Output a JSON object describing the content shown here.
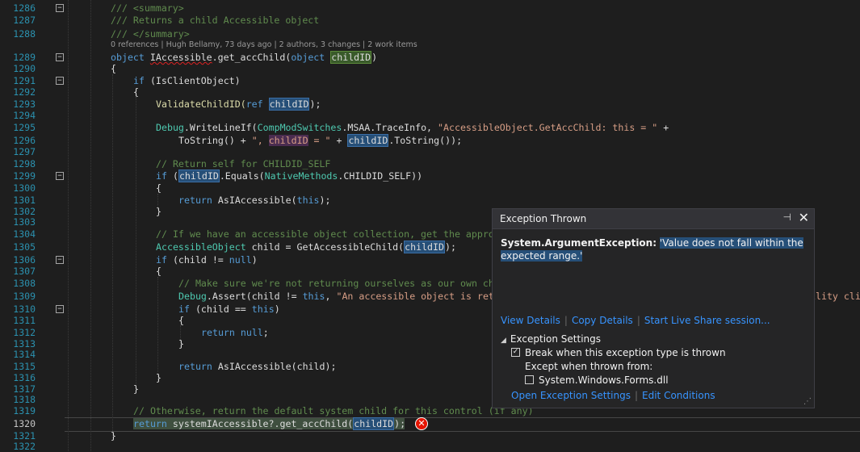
{
  "gutter": {
    "line_numbers": [
      "1286",
      "1287",
      "1288",
      "1289",
      "1290",
      "1291",
      "1292",
      "1293",
      "1294",
      "1295",
      "1296",
      "1297",
      "1298",
      "1299",
      "1300",
      "1301",
      "1302",
      "1303",
      "1304",
      "1305",
      "1306",
      "1307",
      "1308",
      "1309",
      "1310",
      "1311",
      "1312",
      "1313",
      "1314",
      "1315",
      "1316",
      "1317",
      "1318",
      "1319",
      "1320",
      "1321",
      "1322"
    ]
  },
  "codelens": {
    "text": "0 references | Hugh Bellamy, 73 days ago | 2 authors, 3 changes | 2 work items"
  },
  "code": {
    "l1286_c": "/// <summary>",
    "l1287_c": "/// Returns a child Accessible object",
    "l1288_c": "/// </summary>",
    "l1289_a": "object ",
    "l1289_b": "IAccessible",
    "l1289_c": ".get_accChild(",
    "l1289_d": "object ",
    "l1289_e": "childID",
    "l1289_f": ")",
    "l1290": "{",
    "l1291_a": "if ",
    "l1291_b": "(IsClientObject)",
    "l1292": "{",
    "l1293_a": "ValidateChildID(",
    "l1293_b": "ref ",
    "l1293_c": "childID",
    "l1293_d": ");",
    "l1295_a": "Debug",
    "l1295_b": ".WriteLineIf(",
    "l1295_c": "CompModSwitches",
    "l1295_d": ".MSAA.TraceInfo, ",
    "l1295_e": "\"AccessibleObject.GetAccChild: this = \"",
    "l1295_f": " +",
    "l1296_a": "ToString() + ",
    "l1296_b": "\", ",
    "l1296_c": "childID",
    "l1296_d": " = \"",
    "l1296_e": " + ",
    "l1296_f": "childID",
    "l1296_g": ".ToString());",
    "l1298_c": "// Return self for CHILDID_SELF",
    "l1299_a": "if ",
    "l1299_b": "(",
    "l1299_c": "childID",
    "l1299_d": ".Equals(",
    "l1299_e": "NativeMethods",
    "l1299_f": ".CHILDID_SELF))",
    "l1300": "{",
    "l1301_a": "return ",
    "l1301_b": "AsIAccessible(",
    "l1301_c": "this",
    "l1301_d": ");",
    "l1302": "}",
    "l1304_c": "// If we have an accessible object collection, get the appro",
    "l1305_a": "AccessibleObject",
    "l1305_b": " child = GetAccessibleChild(",
    "l1305_c": "childID",
    "l1305_d": ");",
    "l1306_a": "if ",
    "l1306_b": "(child != ",
    "l1306_c": "null",
    "l1306_d": ")",
    "l1307": "{",
    "l1308_c": "// Make sure we're not returning ourselves as our own ch",
    "l1309_a": "Debug",
    "l1309_b": ".Assert(child != ",
    "l1309_c": "this",
    "l1309_d": ", ",
    "l1309_e": "\"An accessible object is ret",
    "l1309_tail": "ility clie",
    "l1310_a": "if ",
    "l1310_b": "(child == ",
    "l1310_c": "this",
    "l1310_d": ")",
    "l1311": "{",
    "l1312_a": "return ",
    "l1312_b": "null",
    "l1312_c": ";",
    "l1313": "}",
    "l1315_a": "return ",
    "l1315_b": "AsIAccessible(child);",
    "l1316": "}",
    "l1317": "}",
    "l1319_c": "// Otherwise, return the default system child for this control (if any)",
    "l1320_a": "return ",
    "l1320_b": "systemIAccessible?.get_accChild(",
    "l1320_c": "childID",
    "l1320_d": ");",
    "l1321": "}"
  },
  "error_glyph": "✕",
  "popup": {
    "title": "Exception Thrown",
    "pin_icon": "⊣",
    "close_icon": "✕",
    "exception_type": "System.ArgumentException:",
    "exception_message": "'Value does not fall within the expected range.'",
    "links": {
      "view_details": "View Details",
      "copy_details": "Copy Details",
      "live_share": "Start Live Share session..."
    },
    "settings_header": "Exception Settings",
    "break_when_thrown": "Break when this exception type is thrown",
    "break_checked": true,
    "except_when_thrown_from": "Except when thrown from:",
    "module": "System.Windows.Forms.dll",
    "module_checked": false,
    "open_settings": "Open Exception Settings",
    "edit_conditions": "Edit Conditions",
    "grip_icon": "⋰"
  },
  "colors": {
    "editor_bg": "#1e1e1e",
    "keyword": "#569cd6",
    "comment": "#57a64a",
    "string": "#d69d85",
    "type": "#4ec9b0",
    "link": "#3794ff",
    "error": "#e51400"
  }
}
